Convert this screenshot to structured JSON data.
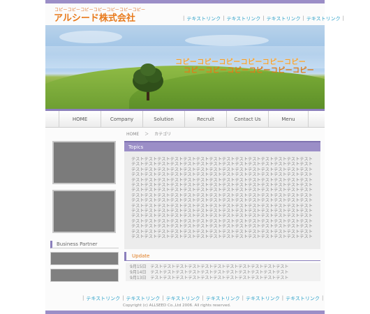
{
  "header": {
    "tagline": "コピーコピーコピーコピーコピーコピーコピー",
    "company_name": "アルシード株式会社",
    "links": [
      "テキストリンク",
      "テキストリンク",
      "テキストリンク",
      "テキストリンク"
    ]
  },
  "hero": {
    "catchcopy_1": "コピーコピーコピーコピーコピーコピー",
    "catchcopy_2": "コピーコピーコピーコピーコピーコピー"
  },
  "nav": {
    "items": [
      "HOME",
      "Company",
      "Solution",
      "Recruit",
      "Contact Us",
      "Menu"
    ]
  },
  "breadcrumb": {
    "home": "HOME",
    "separator": "＞",
    "current": "カテゴリ"
  },
  "sidebar": {
    "partner_title": "Business Partner"
  },
  "topics": {
    "title": "Topics",
    "body": "テストテストテストテストテストテストテストテストテストテストテストテストテストテストテストテストテストテストテストテストテストテストテストテストテストテストテストテストテストテストテストテストテストテストテストテストテストテストテストテストテストテストテストテストテストテストテストテストテストテストテストテストテストテストテストテストテストテストテストテストテストテストテストテストテストテストテストテストテストテストテストテストテストテストテストテストテストテストテストテストテストテストテストテストテストテストテストテストテストテストテストテストテストテストテストテストテストテストテストテストテストテストテストテストテストテストテストテストテストテストテストテストテストテストテストテストテストテストテストテストテストテストテストテストテストテストテストテストテストテストテストテストテストテストテストテストテストテストテストテストテストテストテストテストテストテストテストテストテストテストテストテストテストテストテストテストテストテストテストテストテストテストテストテストテストテストテストテストテストテストテストテストテストテストテストテストテストテストテストテストテストテストテストテストテストテストテストテストテストテストテストテストテストテストテストテストテストテストテストテストテストテストテストテストテストテストテストテストテストテストテストテストテストテストテストテストテストテストテストテストテストテストテストテスト"
  },
  "update": {
    "title": "Update",
    "entries": [
      {
        "date": "9月15日",
        "text": "テストテストテストテストテストテストテストテストテストテストテスト"
      },
      {
        "date": "9月14日",
        "text": "テストテストテストテストテストテストテストテストテストテストテスト"
      },
      {
        "date": "9月13日",
        "text": "テストテストテストテストテストテストテストテストテストテストテスト"
      }
    ]
  },
  "footer": {
    "links": [
      "テキストリンク",
      "テキストリンク",
      "テキストリンク",
      "テキストリンク",
      "テキストリンク",
      "テキストリンク"
    ],
    "copyright": "Copyright (c) ALLSEED Co.,Ltd 2006. All rights reserved."
  },
  "colors": {
    "accent_purple": "#9b8ec7",
    "accent_orange": "#e87a1c",
    "link_blue": "#2aa0c8"
  }
}
